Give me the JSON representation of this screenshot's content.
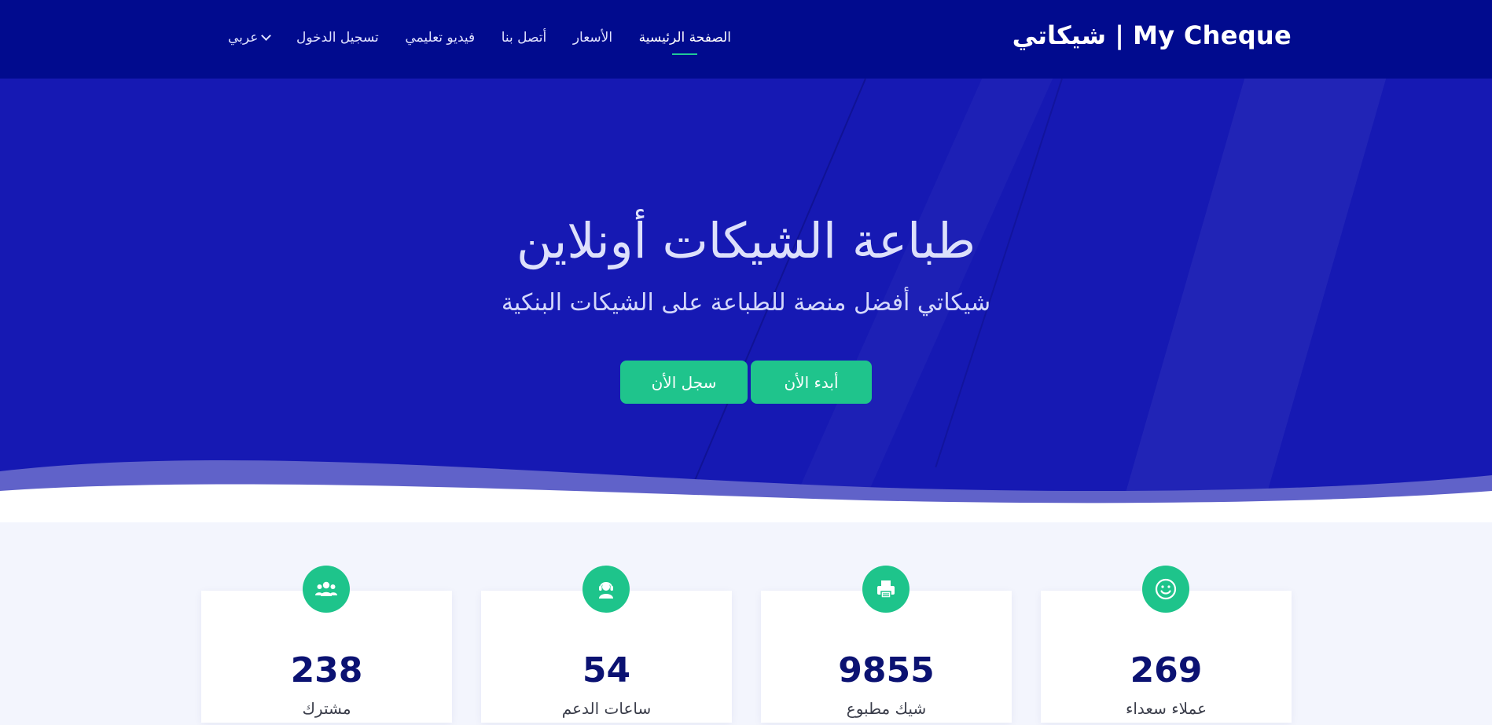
{
  "header": {
    "brand": "شيكاتي | My Cheque",
    "nav": [
      {
        "label": "الصفحة الرئيسية",
        "active": true
      },
      {
        "label": "الأسعار",
        "active": false
      },
      {
        "label": "أتصل بنا",
        "active": false
      },
      {
        "label": "فيديو تعليمي",
        "active": false
      },
      {
        "label": "تسجيل الدخول",
        "active": false
      }
    ],
    "language": "عربي"
  },
  "hero": {
    "title": "طباعة الشيكات أونلاين",
    "subtitle": "شيكاتي أفضل منصة للطباعة على الشيكات البنكية",
    "start_button": "أبدء الأن",
    "register_button": "سجل الأن"
  },
  "stats": [
    {
      "value": "269",
      "label": "عملاء سعداء",
      "icon": "smiley-icon"
    },
    {
      "value": "9855",
      "label": "شيك مطبوع",
      "icon": "printer-icon"
    },
    {
      "value": "54",
      "label": "ساعات الدعم",
      "icon": "support-agent-icon"
    },
    {
      "value": "238",
      "label": "مشترك",
      "icon": "users-icon"
    }
  ],
  "colors": {
    "navbar": "#010b8e",
    "hero": "#1619b3",
    "accent": "#1fc48c",
    "stat_text": "#0b1272"
  }
}
